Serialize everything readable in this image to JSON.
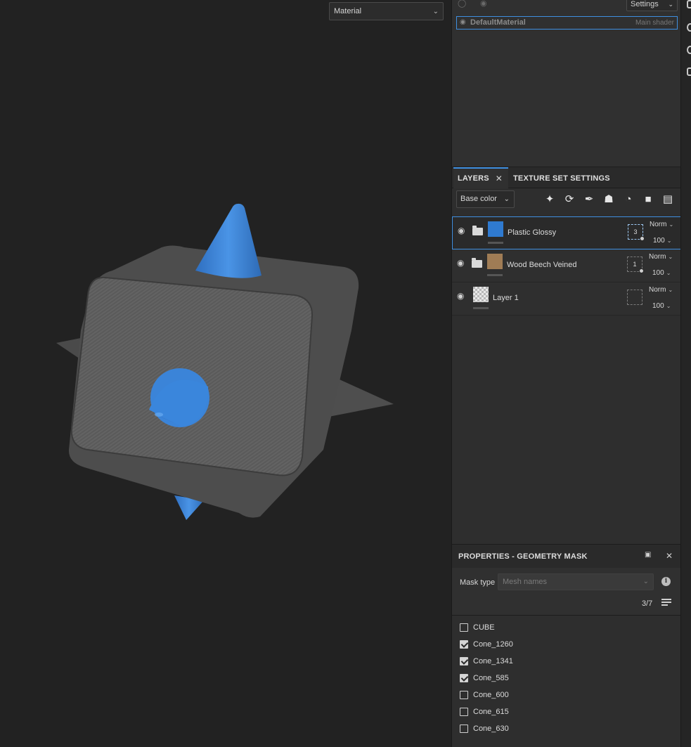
{
  "viewport": {
    "channel_select": "Material"
  },
  "shader": {
    "settings_label": "Settings",
    "material_name": "DefaultMaterial",
    "material_tag": "Main shader"
  },
  "layers_panel": {
    "tabs": [
      {
        "label": "LAYERS"
      },
      {
        "label": "TEXTURE SET SETTINGS"
      }
    ],
    "channel_select": "Base color",
    "layers": [
      {
        "name": "Plastic Glossy",
        "mask_count": "3",
        "blend": "Norm",
        "opacity": "100",
        "thumb_color": "#2f7ad0"
      },
      {
        "name": "Wood Beech Veined",
        "mask_count": "1",
        "blend": "Norm",
        "opacity": "100",
        "thumb_color": "#a07c55"
      },
      {
        "name": "Layer 1",
        "mask_count": "",
        "blend": "Norm",
        "opacity": "100",
        "thumb_color": "checker"
      }
    ]
  },
  "properties": {
    "title": "PROPERTIES - GEOMETRY MASK",
    "mask_type_label": "Mask type",
    "mask_type_value": "Mesh names",
    "count": "3/7",
    "meshes": [
      {
        "name": "CUBE",
        "checked": false
      },
      {
        "name": "Cone_1260",
        "checked": true
      },
      {
        "name": "Cone_1341",
        "checked": true
      },
      {
        "name": "Cone_585",
        "checked": true
      },
      {
        "name": "Cone_600",
        "checked": false
      },
      {
        "name": "Cone_615",
        "checked": false
      },
      {
        "name": "Cone_630",
        "checked": false
      }
    ]
  },
  "colors": {
    "accent": "#3f8fe0",
    "cube": "#5c5c5c",
    "cone": "#3b84d8"
  }
}
